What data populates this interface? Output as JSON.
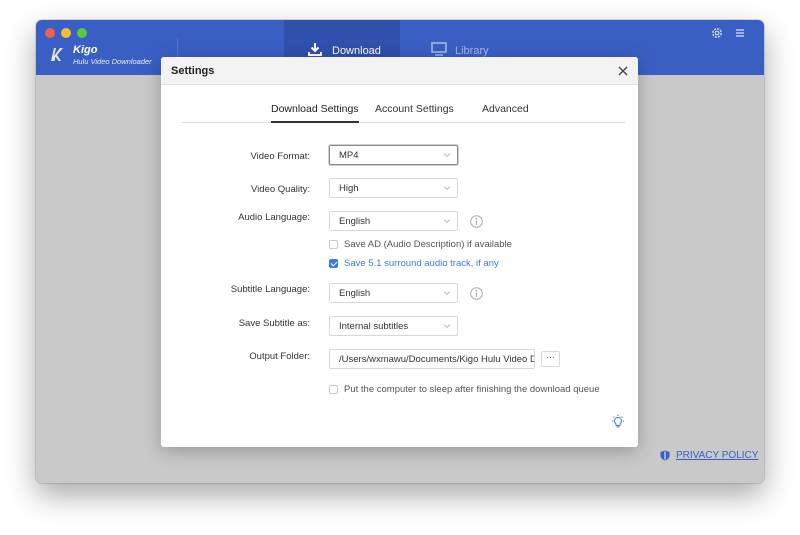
{
  "app": {
    "brand_name": "Kigo",
    "brand_subtitle": "Hulu Video Downloader",
    "nav": {
      "download_label": "Download",
      "library_label": "Library"
    },
    "privacy_label": "PRIVACY POLICY",
    "colors": {
      "header": "#3a5fc4",
      "accent": "#3a7ae0"
    }
  },
  "dialog": {
    "title": "Settings",
    "tabs": [
      {
        "label": "Download Settings",
        "active": true
      },
      {
        "label": "Account Settings",
        "active": false
      },
      {
        "label": "Advanced",
        "active": false
      }
    ],
    "fields": {
      "video_format": {
        "label": "Video Format:",
        "value": "MP4"
      },
      "video_quality": {
        "label": "Video Quality:",
        "value": "High"
      },
      "audio_language": {
        "label": "Audio Language:",
        "value": "English"
      },
      "subtitle_language": {
        "label": "Subtitle Language:",
        "value": "English"
      },
      "save_subtitle_as": {
        "label": "Save Subtitle as:",
        "value": "Internal subtitles"
      },
      "output_folder": {
        "label": "Output Folder:",
        "value": "/Users/wxmawu/Documents/Kigo Hulu Video D",
        "more": "···"
      }
    },
    "checks": {
      "save_ad": {
        "label": "Save AD (Audio Description) if available",
        "checked": false
      },
      "save_51": {
        "label": "Save 5.1 surround audio track, if any",
        "checked": true
      },
      "sleep": {
        "label": "Put the computer to sleep after finishing the download queue",
        "checked": false
      }
    }
  }
}
